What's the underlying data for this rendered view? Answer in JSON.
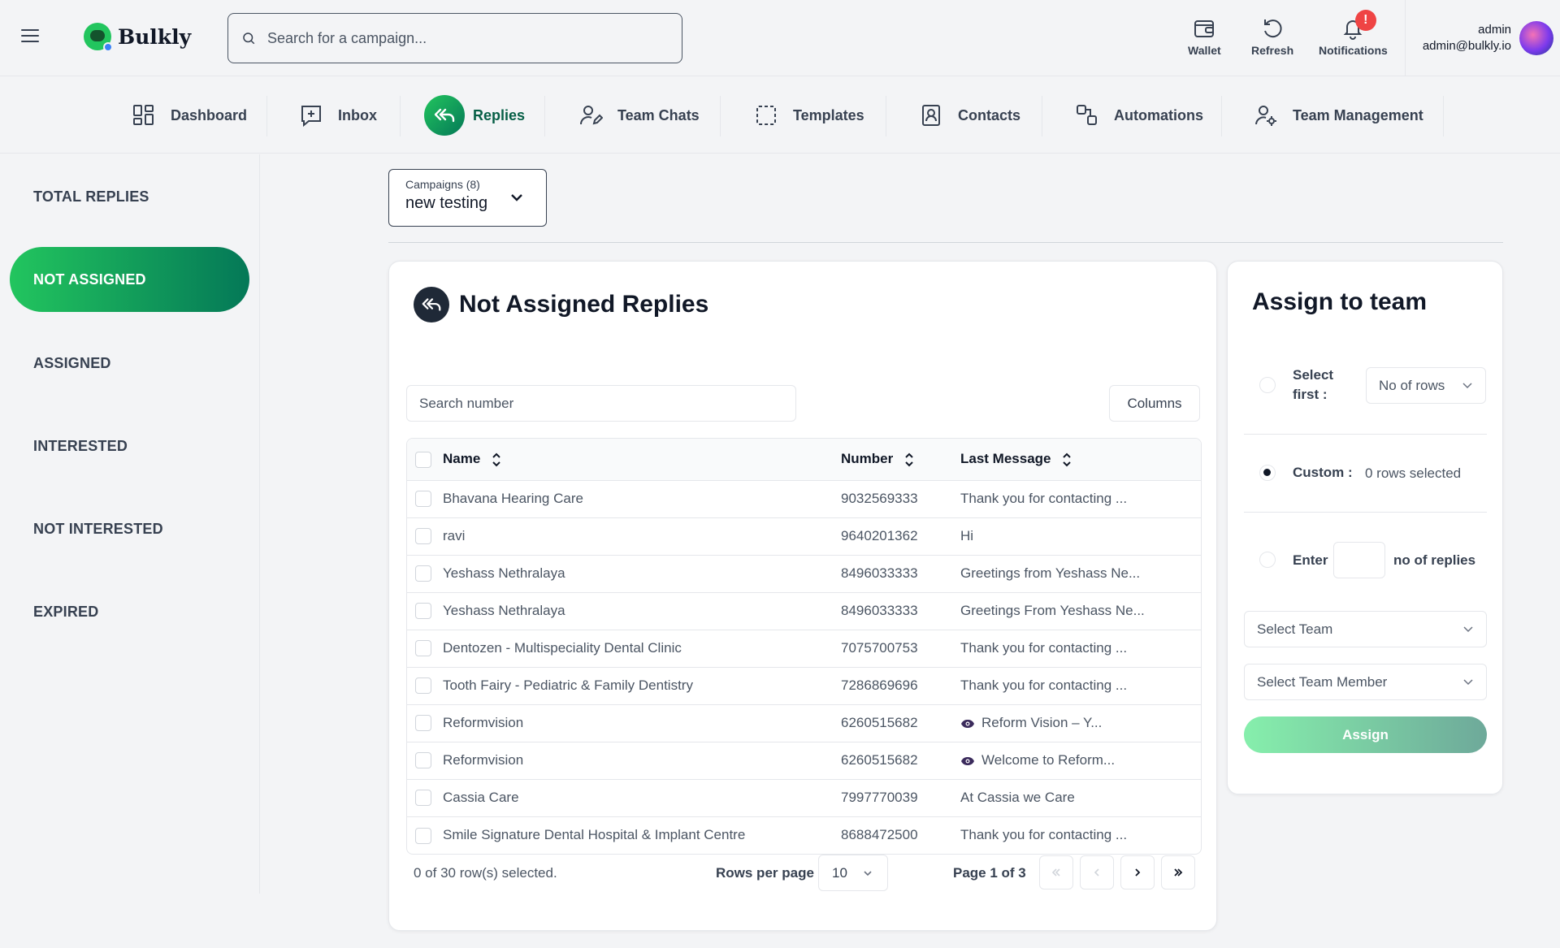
{
  "header": {
    "brand": "Bulkly",
    "search_placeholder": "Search for a campaign...",
    "actions": {
      "wallet": "Wallet",
      "refresh": "Refresh",
      "notifications": "Notifications",
      "notifications_badge": "!"
    },
    "user": {
      "name": "admin",
      "email": "admin@bulkly.io"
    }
  },
  "nav": {
    "dashboard": "Dashboard",
    "inbox": "Inbox",
    "replies": "Replies",
    "team_chats": "Team Chats",
    "templates": "Templates",
    "contacts": "Contacts",
    "automations": "Automations",
    "team_management": "Team Management"
  },
  "sidebar": {
    "total_replies": "TOTAL REPLIES",
    "not_assigned": "NOT ASSIGNED",
    "assigned": "ASSIGNED",
    "interested": "INTERESTED",
    "not_interested": "NOT INTERESTED",
    "expired": "EXPIRED"
  },
  "campaign": {
    "label": "Campaigns (8)",
    "value": "new testing"
  },
  "main": {
    "title": "Not Assigned Replies",
    "search_placeholder": "Search number",
    "columns_label": "Columns",
    "headers": {
      "name": "Name",
      "number": "Number",
      "last_message": "Last Message"
    },
    "rows": {
      "r0": {
        "name": "Bhavana Hearing Care",
        "number": "9032569333",
        "message": "Thank you for contacting ..."
      },
      "r1": {
        "name": "ravi",
        "number": "9640201362",
        "message": "Hi"
      },
      "r2": {
        "name": "Yeshass Nethralaya",
        "number": "8496033333",
        "message": "Greetings from Yeshass Ne..."
      },
      "r3": {
        "name": "Yeshass Nethralaya",
        "number": "8496033333",
        "message": "Greetings From Yeshass Ne..."
      },
      "r4": {
        "name": "Dentozen - Multispeciality Dental Clinic",
        "number": "7075700753",
        "message": "Thank you for contacting ..."
      },
      "r5": {
        "name": "Tooth Fairy - Pediatric & Family Dentistry",
        "number": "7286869696",
        "message": "Thank you for contacting ..."
      },
      "r6": {
        "name": "Reformvision",
        "number": "6260515682",
        "message": "Reform Vision – Y..."
      },
      "r7": {
        "name": "Reformvision",
        "number": "6260515682",
        "message": "Welcome to Reform..."
      },
      "r8": {
        "name": "Cassia Care",
        "number": "7997770039",
        "message": "At Cassia we Care"
      },
      "r9": {
        "name": "Smile Signature Dental Hospital & Implant Centre",
        "number": "8688472500",
        "message": "Thank you for contacting ..."
      }
    },
    "footer": {
      "selected": "0 of 30 row(s) selected.",
      "rows_per_page_label": "Rows per page",
      "rows_per_page_value": "10",
      "page_label": "Page 1 of 3"
    }
  },
  "assign": {
    "title": "Assign to team",
    "select_first_label": "Select first :",
    "no_of_rows_placeholder": "No of rows",
    "custom_label": "Custom :",
    "rows_selected": "0 rows selected",
    "enter_label": "Enter",
    "no_of_replies_label": "no of replies",
    "select_team": "Select Team",
    "select_team_member": "Select Team Member",
    "assign_button": "Assign"
  },
  "colors": {
    "accent_start": "#22c55e",
    "accent_end": "#047857",
    "notification": "#ef4444"
  },
  "icons": {
    "menu": "hamburger-icon",
    "search": "search-icon",
    "wallet": "wallet-icon",
    "refresh": "refresh-icon",
    "bell": "bell-icon",
    "reply": "reply-all-icon",
    "eye": "eye-icon",
    "sort": "sort-icon"
  }
}
